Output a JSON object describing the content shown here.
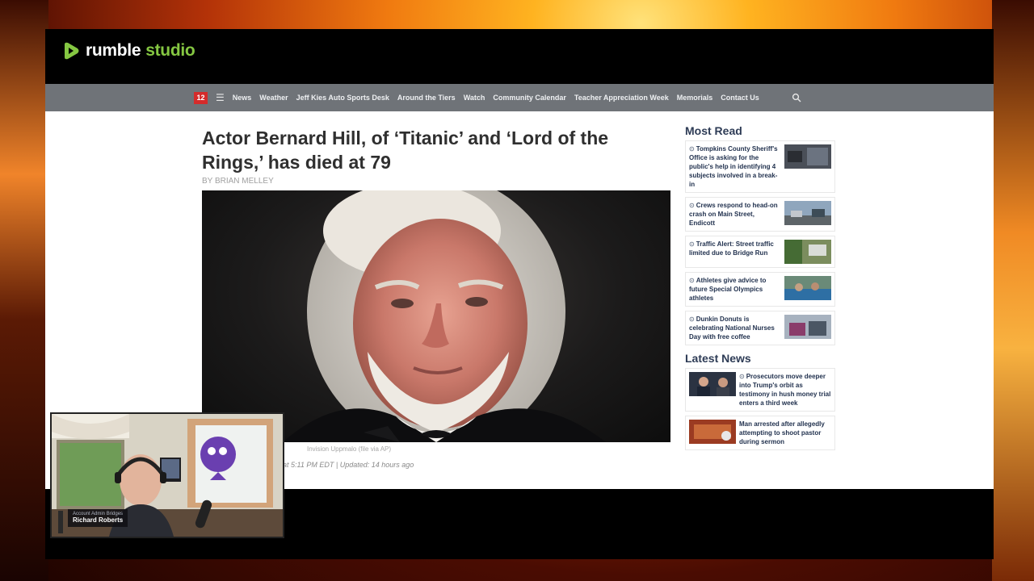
{
  "studio": {
    "brand_primary": "rumble",
    "brand_secondary": "studio",
    "brand_color": "#85c742"
  },
  "site": {
    "logo_text": "12",
    "nav_items": [
      "News",
      "Weather",
      "Jeff Kies Auto Sports Desk",
      "Around the Tiers",
      "Watch",
      "Community Calendar",
      "Teacher Appreciation Week",
      "Memorials",
      "Contact Us"
    ]
  },
  "article": {
    "headline": "Actor Bernard Hill, of ‘Titanic’ and ‘Lord of the Rings,’ has died at 79",
    "byline": "BY BRIAN MELLEY",
    "caption": "Invision Uppmalo (file via AP)",
    "timestamp": "at 5:11 PM EDT  |  Updated: 14 hours ago"
  },
  "sidebar": {
    "most_read_title": "Most Read",
    "most_read": [
      {
        "text": "Tompkins County Sheriff's Office is asking for the public's help in identifying 4 subjects involved in a break-in"
      },
      {
        "text": "Crews respond to head-on crash on Main Street, Endicott"
      },
      {
        "text": "Traffic Alert: Street traffic limited due to Bridge Run"
      },
      {
        "text": "Athletes give advice to future Special Olympics athletes"
      },
      {
        "text": "Dunkin Donuts is celebrating National Nurses Day with free coffee"
      }
    ],
    "latest_title": "Latest News",
    "latest": [
      {
        "text": "Prosecutors move deeper into Trump's orbit as testimony in hush money trial enters a third week"
      },
      {
        "text": "Man arrested after allegedly attempting to shoot pastor during sermon"
      }
    ]
  },
  "webcam": {
    "subtitle": "Account Admin Bridges",
    "name": "Richard Roberts"
  },
  "icons": {
    "brand": "rumble-play-icon",
    "menu": "hamburger-menu-icon",
    "search": "search-icon",
    "bullet": "play-bullet-icon"
  }
}
